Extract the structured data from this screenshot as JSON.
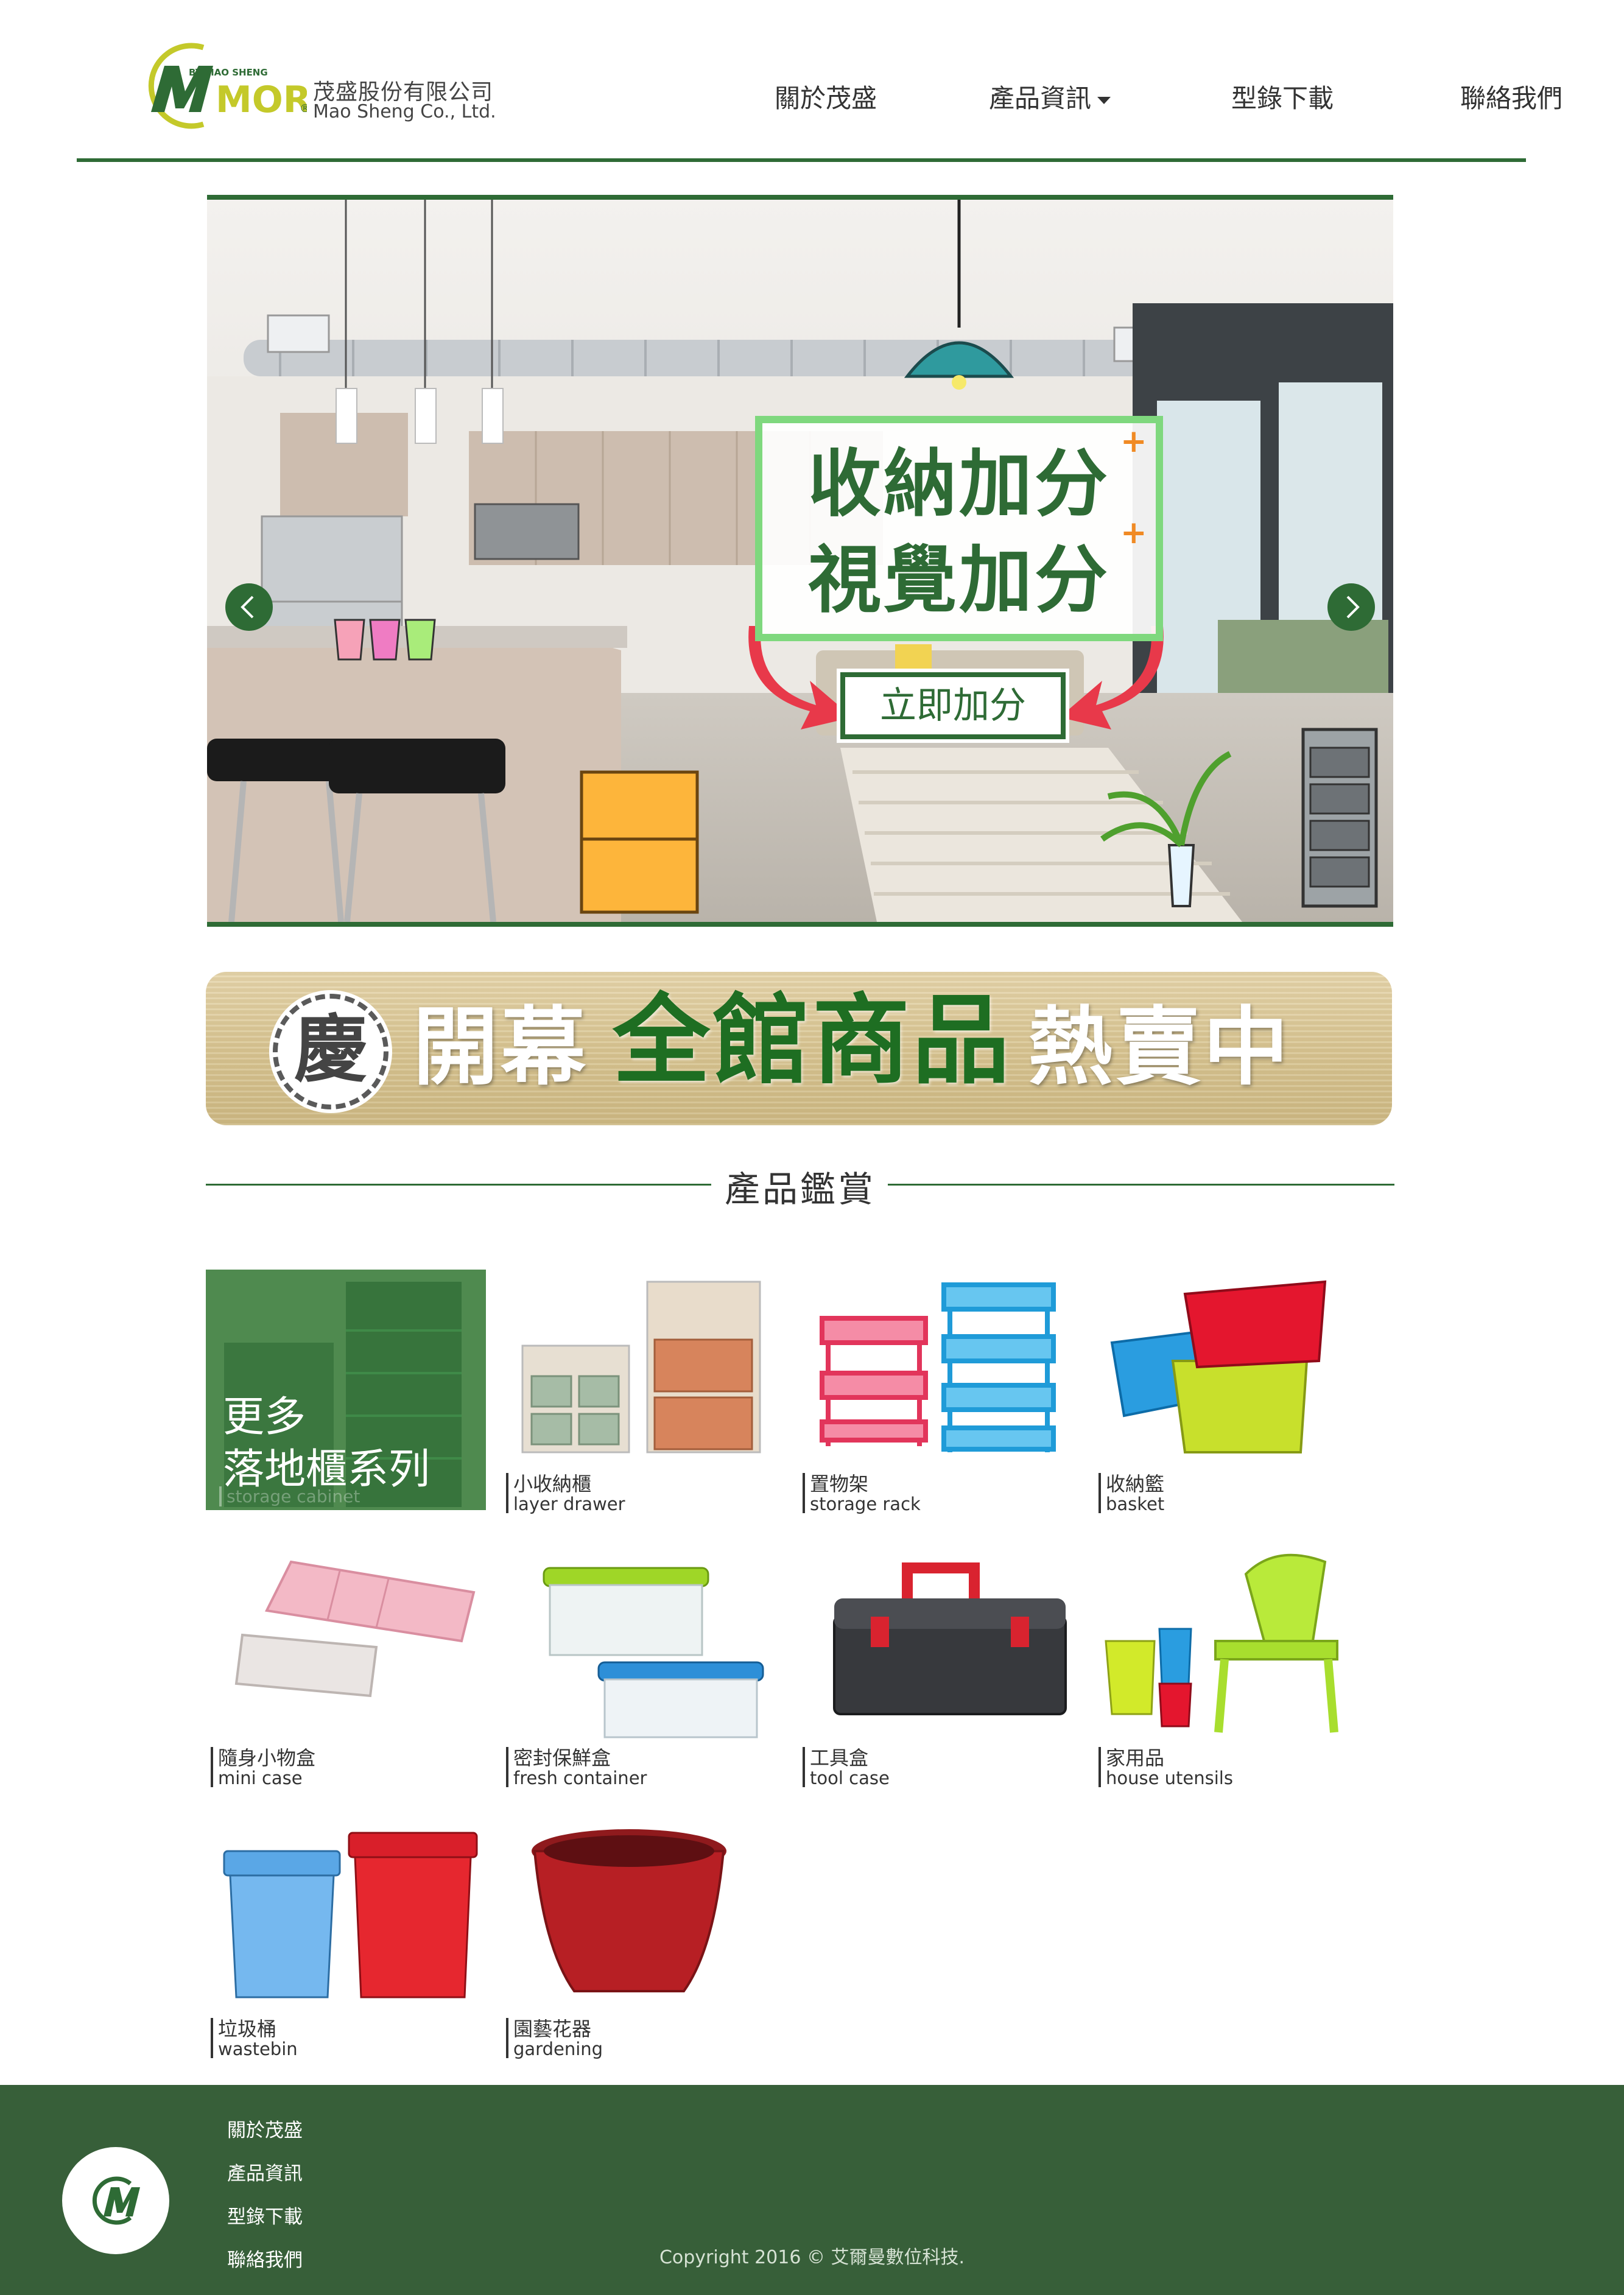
{
  "brand": {
    "logo_tag": "BY MAO SHENG",
    "logo_word": "MORY",
    "company_cn": "茂盛股份有限公司",
    "company_en": "Mao Sheng Co., Ltd.",
    "primary_color": "#2e6b35",
    "accent_color": "#7fd87e",
    "logo_yellow": "#c4c92a"
  },
  "nav": {
    "items": [
      {
        "label": "關於茂盛"
      },
      {
        "label": "產品資訊",
        "has_dropdown": true
      },
      {
        "label": "型錄下載"
      },
      {
        "label": "聯絡我們"
      }
    ]
  },
  "hero": {
    "line1": "收納加分",
    "line2": "視覺加分",
    "plus": "+",
    "button": "立即加分",
    "prev_icon": "chevron-left-icon",
    "next_icon": "chevron-right-icon"
  },
  "promo": {
    "badge": "慶",
    "text1": "開幕",
    "text2": "全館商品",
    "text3": "熱賣中"
  },
  "section": {
    "title": "產品鑑賞"
  },
  "products": {
    "featured": {
      "line1": "更多",
      "line2": "落地櫃系列",
      "faded_label": "storage cabinet"
    },
    "items": [
      {
        "cn": "小收納櫃",
        "en": "layer drawer"
      },
      {
        "cn": "置物架",
        "en": "storage rack"
      },
      {
        "cn": "收納籃",
        "en": "basket"
      },
      {
        "cn": "隨身小物盒",
        "en": "mini case"
      },
      {
        "cn": "密封保鮮盒",
        "en": "fresh container"
      },
      {
        "cn": "工具盒",
        "en": "tool case"
      },
      {
        "cn": "家用品",
        "en": "house utensils"
      },
      {
        "cn": "垃圾桶",
        "en": "wastebin"
      },
      {
        "cn": "園藝花器",
        "en": "gardening"
      }
    ]
  },
  "footer": {
    "links": [
      "關於茂盛",
      "產品資訊",
      "型錄下載",
      "聯絡我們"
    ],
    "copyright": "Copyright 2016 © 艾爾曼數位科技."
  }
}
